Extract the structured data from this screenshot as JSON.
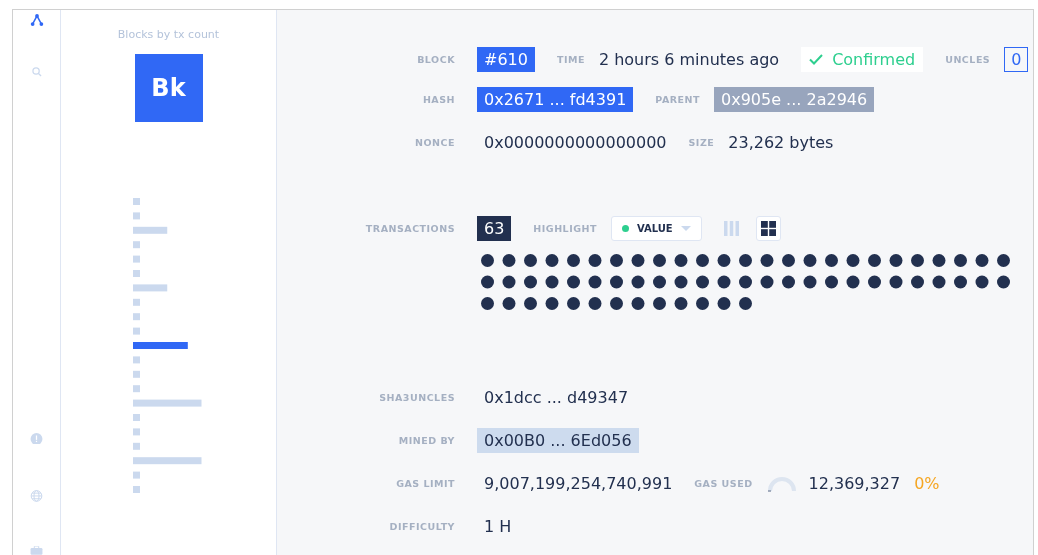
{
  "chart_panel": {
    "title": "Blocks by tx count",
    "badge": "Bk"
  },
  "block": {
    "label": "BLOCK",
    "value": "#610"
  },
  "time": {
    "label": "TIME",
    "value": "2 hours 6 minutes ago"
  },
  "status": {
    "value": "Confirmed",
    "confirmed": true
  },
  "uncles": {
    "label": "UNCLES",
    "value": "0"
  },
  "hash": {
    "label": "HASH",
    "value": "0x2671 ... fd4391"
  },
  "parent": {
    "label": "PARENT",
    "value": "0x905e ... 2a2946"
  },
  "nonce": {
    "label": "NONCE",
    "value": "0x0000000000000000"
  },
  "size": {
    "label": "SIZE",
    "value": "23,262 bytes"
  },
  "transactions": {
    "label": "TRANSACTIONS",
    "count": "63"
  },
  "highlight": {
    "label": "HIGHLIGHT",
    "value": "VALUE",
    "color": "#2ecf8f"
  },
  "views": [
    {
      "kind": "bars",
      "selected": false
    },
    {
      "kind": "grid",
      "selected": true
    }
  ],
  "sha3uncles": {
    "label": "SHA3UNCLES",
    "value": "0x1dcc ... d49347"
  },
  "mined_by": {
    "label": "MINED BY",
    "value": "0x00B0 ... 6Ed056"
  },
  "gas_limit": {
    "label": "GAS LIMIT",
    "value": "9,007,199,254,740,991"
  },
  "gas_used": {
    "label": "GAS USED",
    "value": "12,369,327",
    "percent": "0%"
  },
  "difficulty": {
    "label": "DIFFICULTY",
    "value": "1 H"
  }
}
